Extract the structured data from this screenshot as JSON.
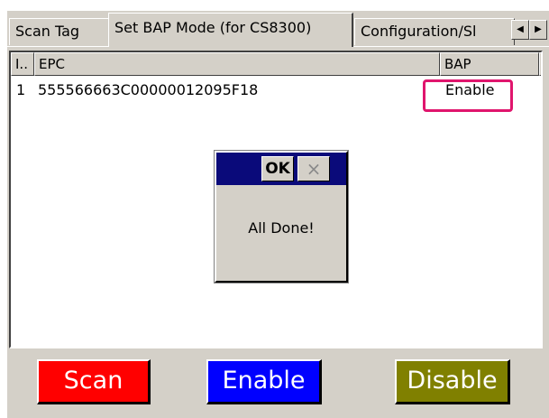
{
  "tabs": [
    {
      "label": "Scan Tag"
    },
    {
      "label": "Set BAP Mode (for CS8300)"
    },
    {
      "label": "Configuration/Sl"
    }
  ],
  "tab_scroll": {
    "left_icon": "left-arrow-icon",
    "right_icon": "right-arrow-icon",
    "left": "◀",
    "right": "▶"
  },
  "table": {
    "columns": [
      "I..",
      "EPC",
      "BAP"
    ],
    "rows": [
      {
        "index": "1",
        "epc": "555566663C00000012095F18",
        "bap": "Enable"
      }
    ]
  },
  "dialog": {
    "ok_label": "OK",
    "close_glyph": "×",
    "message": "All Done!"
  },
  "buttons": {
    "scan": {
      "label": "Scan",
      "bg": "#ff0000",
      "fg": "#ffffff"
    },
    "enable": {
      "label": "Enable",
      "bg": "#0000ff",
      "fg": "#ffffff"
    },
    "disable": {
      "label": "Disable",
      "bg": "#808000",
      "fg": "#ffffff"
    }
  },
  "colors": {
    "highlight": "#e0156d",
    "dialog_title": "#0a0a7a"
  }
}
